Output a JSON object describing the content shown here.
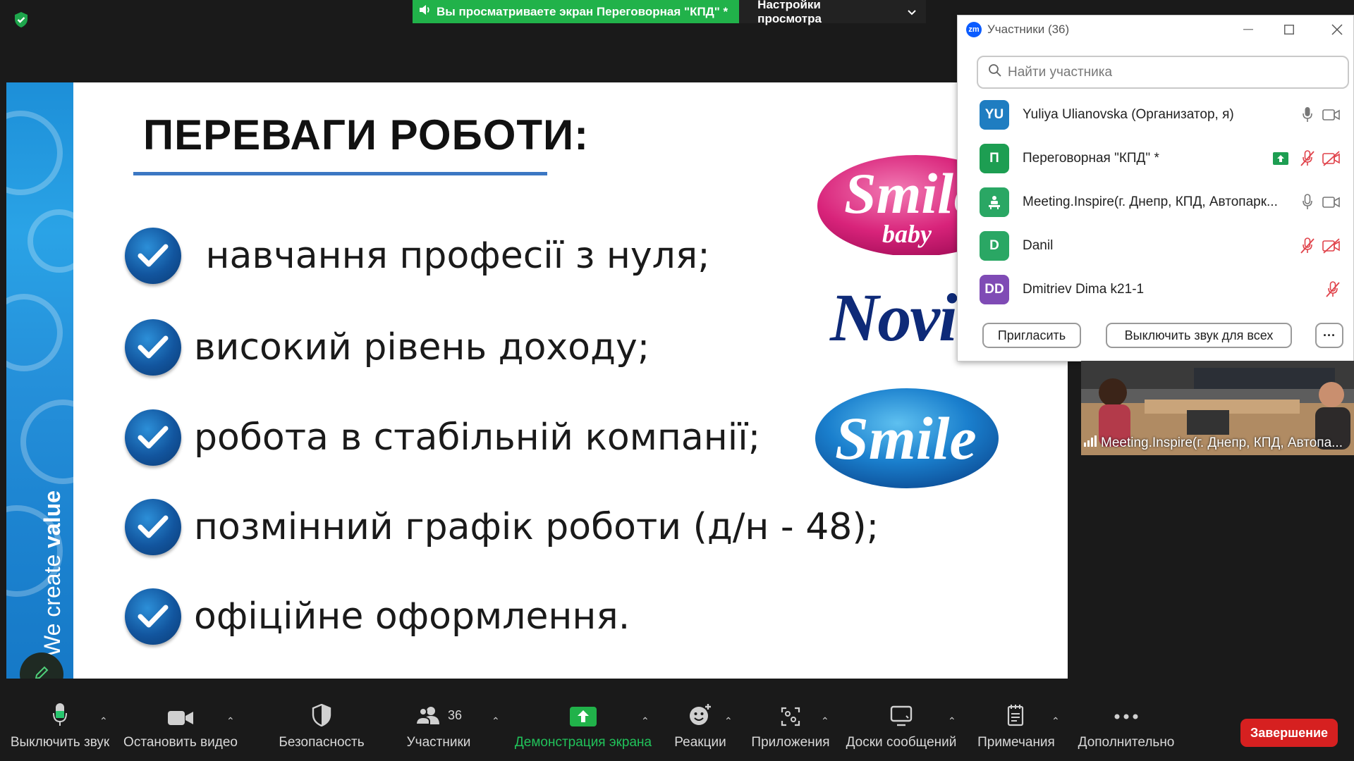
{
  "banner": {
    "viewing_text": "Вы просматриваете экран Переговорная \"КПД\" *",
    "view_settings": "Настройки просмотра"
  },
  "slide": {
    "title": "ПЕРЕВАГИ РОБОТИ:",
    "bullets": [
      " навчання професії з нуля;",
      "високий рівень доходу;",
      "робота в стабільній компанії;",
      "позмінний графік роботи (д/н - 48);",
      "офіційне оформлення."
    ],
    "strip_text_light": "We create ",
    "strip_text_bold": "value",
    "logos": {
      "smile_baby_main": "Smile",
      "smile_baby_sub": "baby",
      "novit": "Novit",
      "smile": "Smile"
    }
  },
  "participants_panel": {
    "title": "Участники (36)",
    "search_placeholder": "Найти участника",
    "participants": [
      {
        "initials": "YU",
        "name": "Yuliya Ulianovska (Организатор, я)",
        "color": "#1f7dc1",
        "mic": "on",
        "video": "on"
      },
      {
        "initials": "П",
        "name": "Переговорная \"КПД\" *",
        "color": "#1d9e52",
        "mic": "muted",
        "video": "off",
        "sharing": true
      },
      {
        "initials": "",
        "name": "Meeting.Inspire(г. Днепр, КПД, Автопарк...",
        "color": "#2aa764",
        "mic": "on",
        "video": "on"
      },
      {
        "initials": "D",
        "name": "Danil",
        "color": "#2aa764",
        "mic": "muted",
        "video": "off"
      },
      {
        "initials": "DD",
        "name": "Dmitriev Dima k21-1",
        "color": "#7f4bb5",
        "mic": "muted"
      }
    ],
    "invite_button": "Пригласить",
    "mute_all_button": "Выключить звук для всех",
    "more_button": "···"
  },
  "thumbnail": {
    "label": "Meeting.Inspire(г. Днепр, КПД, Автопа..."
  },
  "toolbar": {
    "mute": "Выключить звук",
    "video": "Остановить видео",
    "security": "Безопасность",
    "participants": "Участники",
    "participants_count": "36",
    "share": "Демонстрация экрана",
    "reactions": "Реакции",
    "apps": "Приложения",
    "whiteboards": "Доски сообщений",
    "notes": "Примечания",
    "more": "Дополнительно",
    "end": "Завершение"
  },
  "colors": {
    "share_green": "#21b24a",
    "end_red": "#d62020",
    "accent_blue": "#3b77c3"
  }
}
